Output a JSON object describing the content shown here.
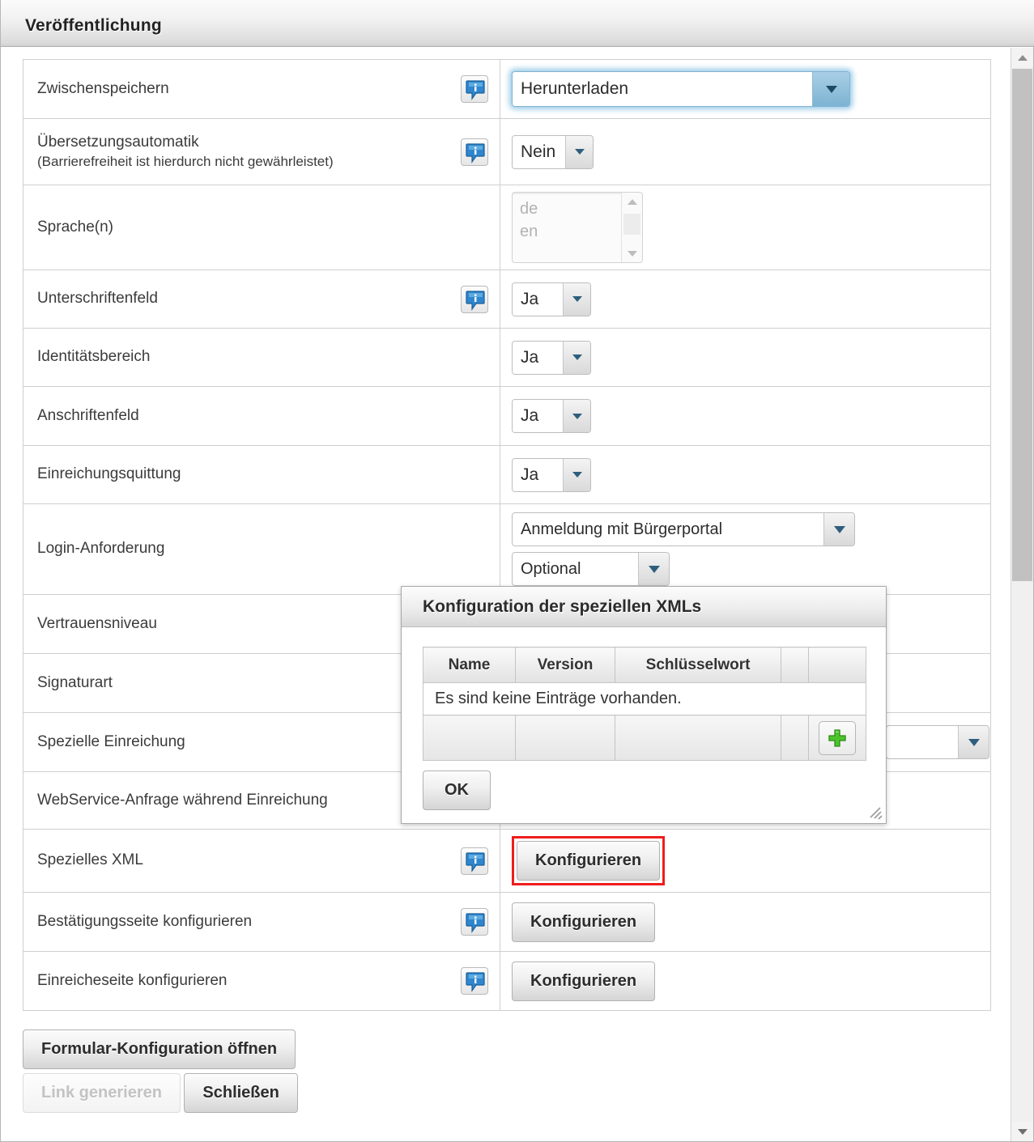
{
  "window": {
    "title": "Veröffentlichung"
  },
  "scrollbar": {
    "up_arrow": "scroll-up-icon",
    "down_arrow": "scroll-down-icon"
  },
  "form": {
    "rows": [
      {
        "label": "Zwischenspeichern",
        "sublabel": "",
        "has_info": true,
        "control": "select-focused",
        "value": "Herunterladen"
      },
      {
        "label": "Übersetzungsautomatik",
        "sublabel": "(Barrierefreiheit ist hierdurch nicht gewährleistet)",
        "has_info": true,
        "control": "select-small",
        "value": "Nein"
      },
      {
        "label": "Sprache(n)",
        "sublabel": "",
        "has_info": false,
        "control": "listbox",
        "value": "de"
      },
      {
        "label": "Unterschriftenfeld",
        "sublabel": "",
        "has_info": true,
        "control": "select-small",
        "value": "Ja"
      },
      {
        "label": "Identitätsbereich",
        "sublabel": "",
        "has_info": false,
        "control": "select-small",
        "value": "Ja"
      },
      {
        "label": "Anschriftenfeld",
        "sublabel": "",
        "has_info": false,
        "control": "select-small",
        "value": "Ja"
      },
      {
        "label": "Einreichungsquittung",
        "sublabel": "",
        "has_info": false,
        "control": "select-small",
        "value": "Ja"
      },
      {
        "label": "Login-Anforderung",
        "sublabel": "",
        "has_info": false,
        "control": "select-double",
        "value": "Anmeldung mit Bürgerportal",
        "value2": "Optional"
      },
      {
        "label": "Vertrauensniveau",
        "sublabel": "",
        "has_info": false,
        "control": "hidden-behind-dialog",
        "value": ""
      },
      {
        "label": "Signaturart",
        "sublabel": "",
        "has_info": false,
        "control": "hidden-behind-dialog",
        "value": ""
      },
      {
        "label": "Spezielle Einreichung",
        "sublabel": "",
        "has_info": false,
        "control": "select-blank",
        "value": ""
      },
      {
        "label": "WebService-Anfrage während Einreichung",
        "sublabel": "",
        "has_info": true,
        "control": "hidden-behind-dialog",
        "value": ""
      },
      {
        "label": "Spezielles XML",
        "sublabel": "",
        "has_info": true,
        "control": "button-highlighted",
        "value": "Konfigurieren"
      },
      {
        "label": "Bestätigungsseite konfigurieren",
        "sublabel": "",
        "has_info": true,
        "control": "button",
        "value": "Konfigurieren"
      },
      {
        "label": "Einreicheseite konfigurieren",
        "sublabel": "",
        "has_info": true,
        "control": "button",
        "value": "Konfigurieren"
      }
    ],
    "language_list": {
      "item1": "de",
      "item2": "en"
    }
  },
  "footer": {
    "open_form_config": "Formular-Konfiguration öffnen",
    "generate_link": "Link generieren",
    "generate_link_disabled": true,
    "close": "Schließen"
  },
  "dialog": {
    "title": "Konfiguration der speziellen XMLs",
    "columns": [
      "Name",
      "Version",
      "Schlüsselwort",
      "",
      ""
    ],
    "empty_message": "Es sind keine Einträge vorhanden.",
    "add_icon": "plus-icon",
    "ok_label": "OK",
    "resize_handle": "resize-handle-icon"
  },
  "colors": {
    "highlight_border": "#ef1d1d",
    "info_icon": "#2f7fc4",
    "add_icon": "#49b02a",
    "select_arrow": "#2f5e7d",
    "focus_glow": "#7dbade"
  }
}
